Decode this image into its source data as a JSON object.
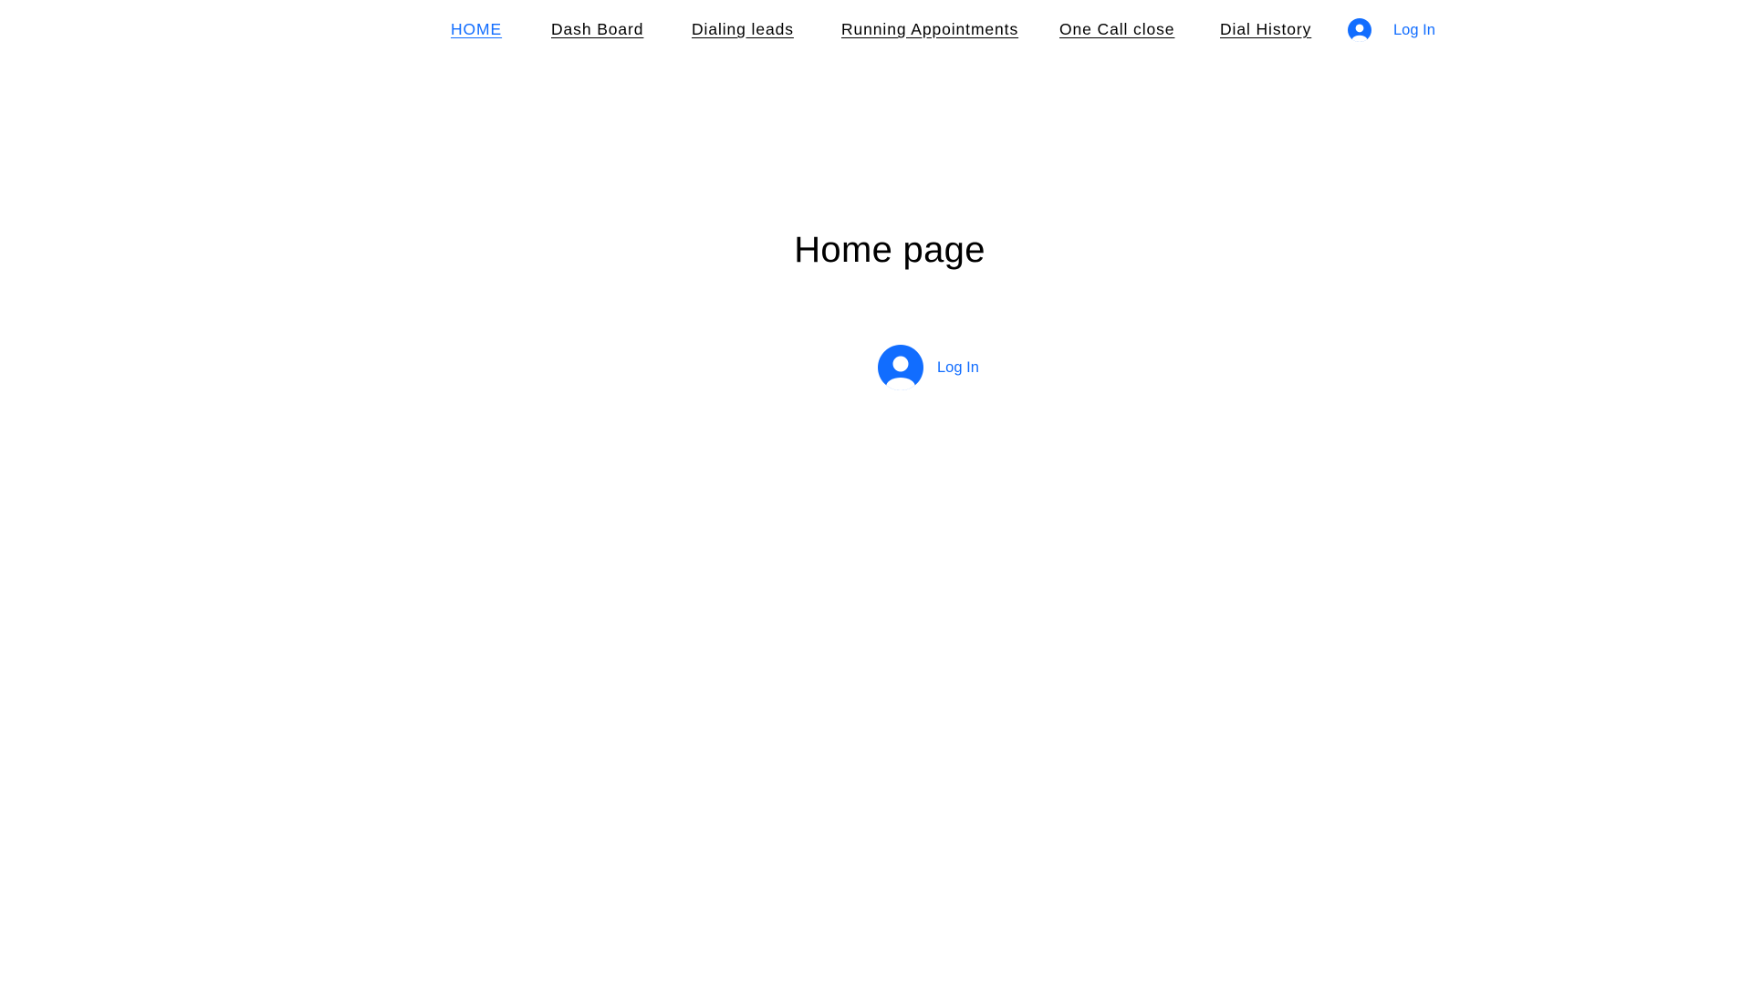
{
  "theme": {
    "accent": "#116dff",
    "text": "#000000",
    "background": "#ffffff"
  },
  "nav": {
    "items": [
      {
        "label": "HOME",
        "active": true
      },
      {
        "label": "Dash Board",
        "active": false
      },
      {
        "label": "Dialing leads",
        "active": false
      },
      {
        "label": "Running Appointments",
        "active": false
      },
      {
        "label": "One Call close",
        "active": false
      },
      {
        "label": "Dial History",
        "active": false
      }
    ],
    "login": {
      "label": "Log In",
      "icon": "user-avatar-icon"
    }
  },
  "main": {
    "title": "Home page",
    "login": {
      "label": "Log In",
      "icon": "user-avatar-icon"
    }
  }
}
